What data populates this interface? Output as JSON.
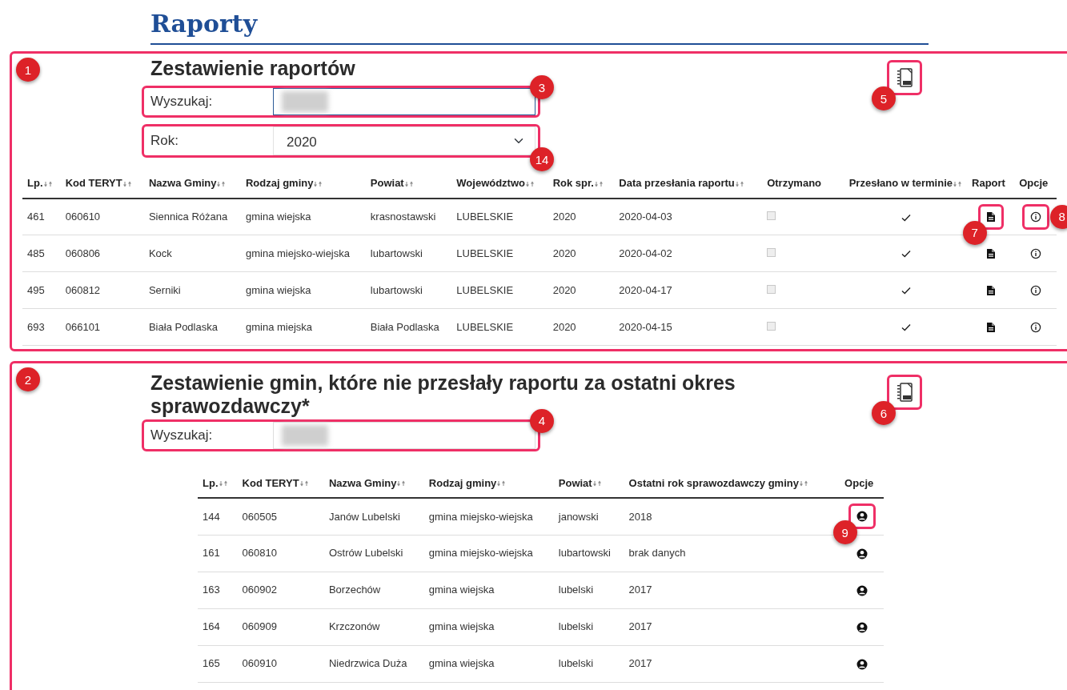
{
  "page_title": "Raporty",
  "sections": [
    {
      "marker": "1",
      "title": "Zestawienie raportów",
      "csv_marker": "5",
      "filters": [
        {
          "kind": "search",
          "label": "Wyszukaj:",
          "focused": true,
          "redacted": true,
          "marker": "3"
        },
        {
          "kind": "select",
          "label": "Rok:",
          "value": "2020",
          "marker": "14"
        }
      ],
      "table": {
        "wide": true,
        "columns": [
          {
            "label": "Lp.",
            "kind": "text",
            "sortable": true
          },
          {
            "label": "Kod TERYT",
            "kind": "text",
            "sortable": true
          },
          {
            "label": "Nazwa Gminy",
            "kind": "text",
            "sortable": true
          },
          {
            "label": "Rodzaj gminy",
            "kind": "text",
            "sortable": true
          },
          {
            "label": "Powiat",
            "kind": "text",
            "sortable": true
          },
          {
            "label": "Województwo",
            "kind": "text",
            "sortable": true
          },
          {
            "label": "Rok spr.",
            "kind": "text",
            "sortable": true
          },
          {
            "label": "Data przesłania raportu",
            "kind": "text",
            "sortable": true
          },
          {
            "label": "Otrzymano",
            "kind": "checkbox",
            "sortable": false
          },
          {
            "label": "Przesłano w terminie",
            "kind": "check",
            "sortable": true
          },
          {
            "label": "Raport",
            "kind": "report",
            "sortable": false
          },
          {
            "label": "Opcje",
            "kind": "info",
            "sortable": false
          }
        ],
        "rows": [
          {
            "cells": [
              "461",
              "060610",
              "Siennica Różana",
              "gmina wiejska",
              "krasnostawski",
              "LUBELSKIE",
              "2020",
              "2020-04-03"
            ],
            "received": false,
            "on_time": true,
            "report_marker": "7",
            "options_marker": "8"
          },
          {
            "cells": [
              "485",
              "060806",
              "Kock",
              "gmina miejsko-wiejska",
              "lubartowski",
              "LUBELSKIE",
              "2020",
              "2020-04-02"
            ],
            "received": false,
            "on_time": true
          },
          {
            "cells": [
              "495",
              "060812",
              "Serniki",
              "gmina wiejska",
              "lubartowski",
              "LUBELSKIE",
              "2020",
              "2020-04-17"
            ],
            "received": false,
            "on_time": true
          },
          {
            "cells": [
              "693",
              "066101",
              "Biała Podlaska",
              "gmina miejska",
              "Biała Podlaska",
              "LUBELSKIE",
              "2020",
              "2020-04-15"
            ],
            "received": false,
            "on_time": true
          }
        ]
      }
    },
    {
      "marker": "2",
      "title": "Zestawienie gmin, które nie przesłały raportu za ostatni okres sprawozdawczy*",
      "csv_marker": "6",
      "filters": [
        {
          "kind": "search",
          "label": "Wyszukaj:",
          "focused": false,
          "redacted": true,
          "marker": "4"
        }
      ],
      "table": {
        "wide": false,
        "columns": [
          {
            "label": "Lp.",
            "kind": "text",
            "sortable": true
          },
          {
            "label": "Kod TERYT",
            "kind": "text",
            "sortable": true
          },
          {
            "label": "Nazwa Gminy",
            "kind": "text",
            "sortable": true
          },
          {
            "label": "Rodzaj gminy",
            "kind": "text",
            "sortable": true
          },
          {
            "label": "Powiat",
            "kind": "text",
            "sortable": true
          },
          {
            "label": "Ostatni rok sprawozdawczy gminy",
            "kind": "text",
            "sortable": true
          },
          {
            "label": "Opcje",
            "kind": "profile",
            "sortable": false
          }
        ],
        "rows": [
          {
            "cells": [
              "144",
              "060505",
              "Janów Lubelski",
              "gmina miejsko-wiejska",
              "janowski",
              "2018"
            ],
            "options_marker": "9"
          },
          {
            "cells": [
              "161",
              "060810",
              "Ostrów Lubelski",
              "gmina miejsko-wiejska",
              "lubartowski",
              "brak danych"
            ]
          },
          {
            "cells": [
              "163",
              "060902",
              "Borzechów",
              "gmina wiejska",
              "lubelski",
              "2017"
            ]
          },
          {
            "cells": [
              "164",
              "060909",
              "Krzczonów",
              "gmina wiejska",
              "lubelski",
              "2017"
            ]
          },
          {
            "cells": [
              "165",
              "060910",
              "Niedrzwica Duża",
              "gmina wiejska",
              "lubelski",
              "2017"
            ]
          }
        ]
      }
    }
  ]
}
